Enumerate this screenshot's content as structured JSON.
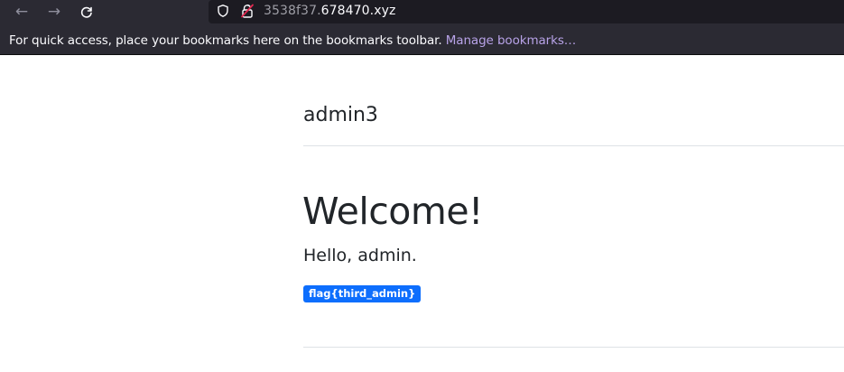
{
  "browser": {
    "nav": {
      "back_icon": "arrow-left-icon",
      "forward_icon": "arrow-right-icon",
      "reload_icon": "reload-icon"
    },
    "url": {
      "subdomain": "3538f37.",
      "domain": "678470.xyz"
    },
    "bookmarks_bar": {
      "message": "For quick access, place your bookmarks here on the bookmarks toolbar. ",
      "link": "Manage bookmarks…"
    }
  },
  "page": {
    "brand": "admin3",
    "heading": "Welcome!",
    "greeting": "Hello, admin.",
    "flag_badge": "flag{third_admin}"
  },
  "colors": {
    "chrome_bg": "#2b2a33",
    "urlbar_bg": "#1c1b22",
    "link": "#b8a3e8",
    "badge_bg": "#0d6efd",
    "text": "#212529"
  }
}
